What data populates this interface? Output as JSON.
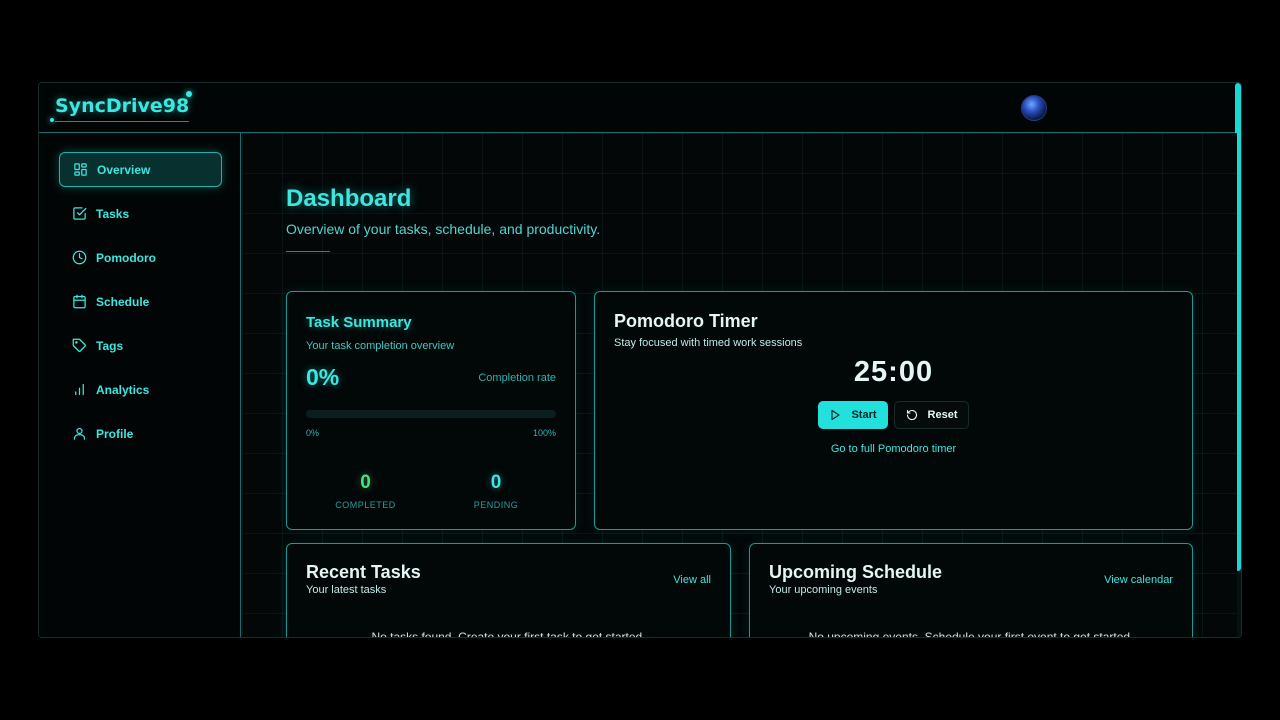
{
  "app": {
    "name": "SyncDrive98"
  },
  "sidebar": {
    "items": [
      {
        "label": "Overview",
        "icon": "layout-grid-icon",
        "active": true
      },
      {
        "label": "Tasks",
        "icon": "check-square-icon",
        "active": false
      },
      {
        "label": "Pomodoro",
        "icon": "clock-icon",
        "active": false
      },
      {
        "label": "Schedule",
        "icon": "calendar-icon",
        "active": false
      },
      {
        "label": "Tags",
        "icon": "tag-icon",
        "active": false
      },
      {
        "label": "Analytics",
        "icon": "bar-chart-icon",
        "active": false
      },
      {
        "label": "Profile",
        "icon": "user-icon",
        "active": false
      }
    ]
  },
  "header": {
    "title": "Dashboard",
    "subtitle": "Overview of your tasks, schedule, and productivity."
  },
  "task_summary": {
    "title": "Task Summary",
    "subtitle": "Your task completion overview",
    "completion_value": "0%",
    "completion_label": "Completion rate",
    "progress_fraction": 0,
    "min_label": "0%",
    "max_label": "100%",
    "completed_count": "0",
    "completed_label": "COMPLETED",
    "pending_count": "0",
    "pending_label": "PENDING"
  },
  "pomodoro": {
    "title": "Pomodoro Timer",
    "subtitle": "Stay focused with timed work sessions",
    "time": "25:00",
    "start_label": "Start",
    "reset_label": "Reset",
    "link_label": "Go to full Pomodoro timer"
  },
  "recent_tasks": {
    "title": "Recent Tasks",
    "subtitle": "Your latest tasks",
    "link_label": "View all",
    "empty_text": "No tasks found. Create your first task to get started."
  },
  "upcoming": {
    "title": "Upcoming Schedule",
    "subtitle": "Your upcoming events",
    "link_label": "View calendar",
    "empty_text": "No upcoming events. Schedule your first event to get started."
  },
  "colors": {
    "accent": "#22e6e0",
    "completed": "#4ade80",
    "pending": "#22e6e0"
  }
}
